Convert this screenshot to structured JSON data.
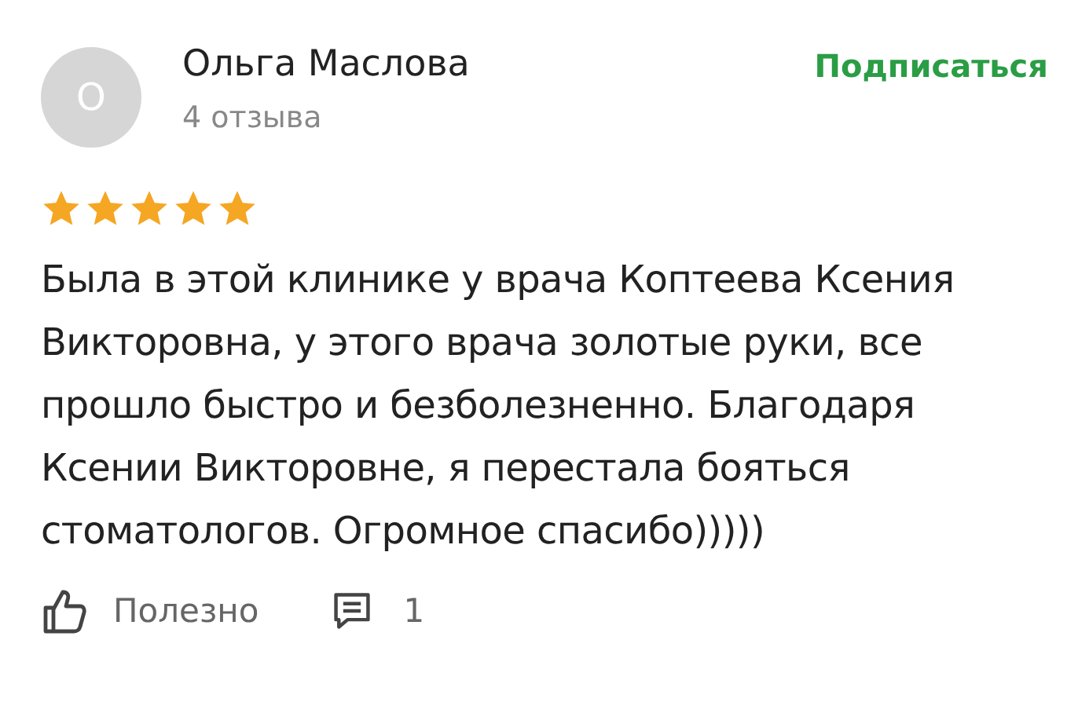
{
  "review": {
    "author": {
      "initial": "О",
      "name": "Ольга Маслова",
      "reviews_count": "4 отзыва"
    },
    "subscribe_button": "Подписаться",
    "stars": 5,
    "text": "Была в этой клинике у врача Коптеева Ксения Викторовна, у этого врача золотые руки, все прошло быстро и безболезненно. Благодаря Ксении Викторовне, я перестала бояться стоматологов. Огромное спасибо)))))",
    "actions": {
      "helpful_label": "Полезно",
      "comments_count": "1"
    }
  }
}
